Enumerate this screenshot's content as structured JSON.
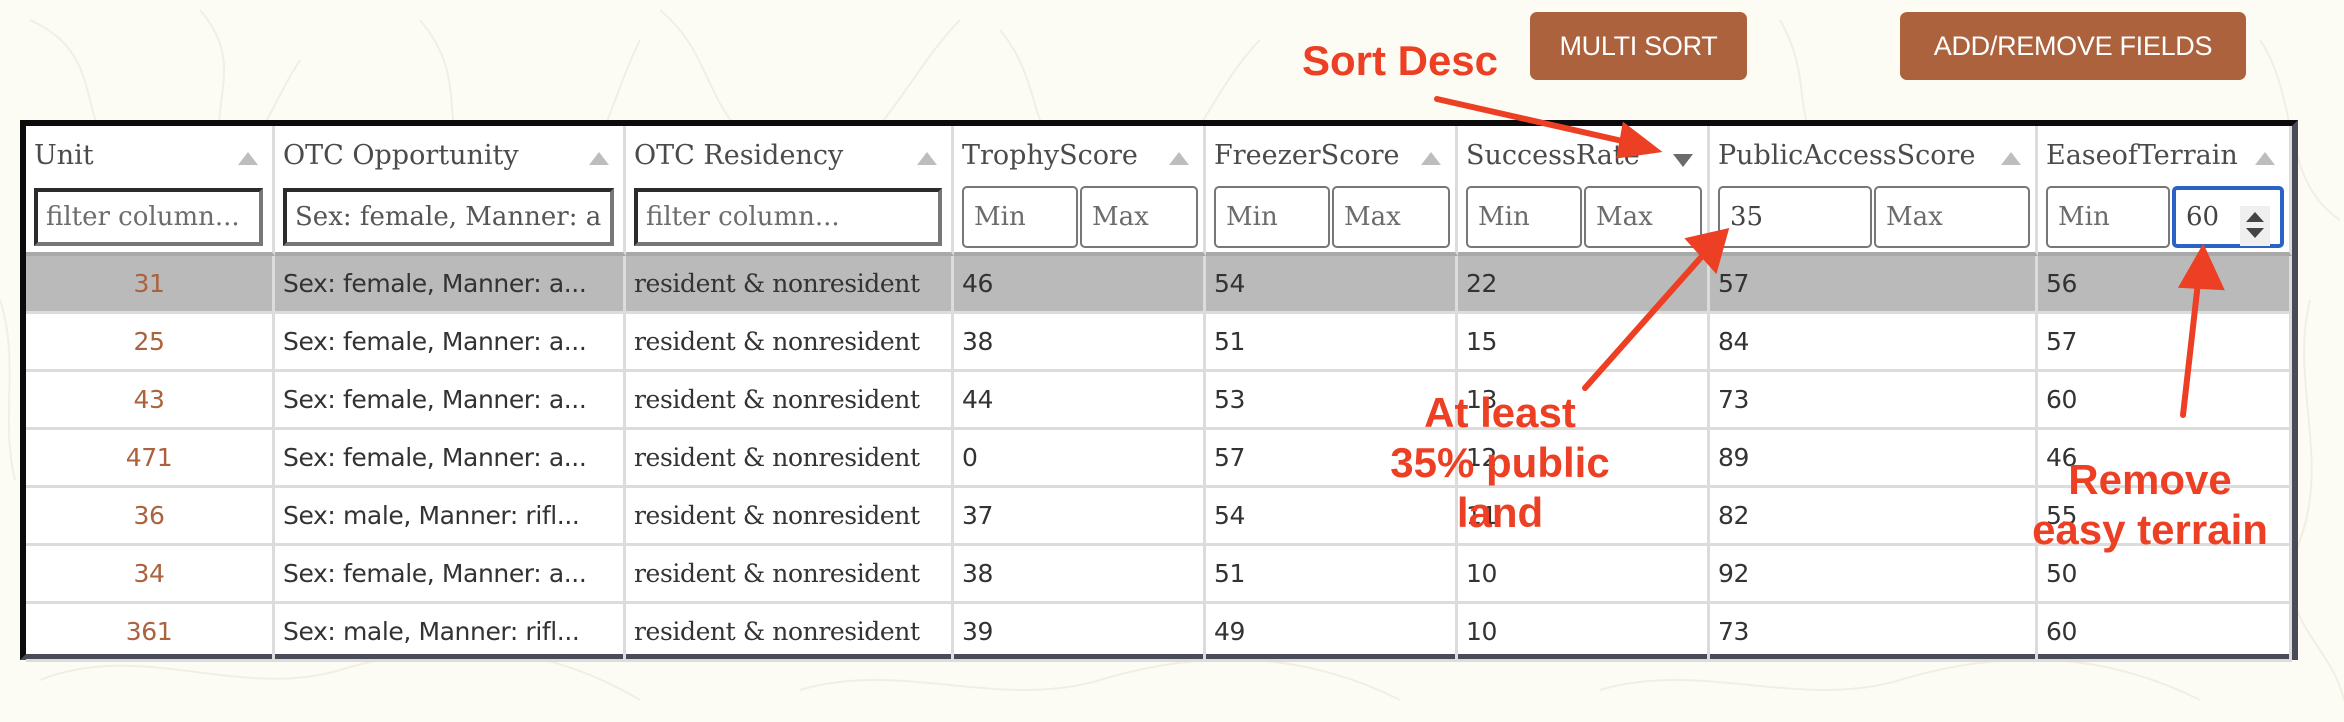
{
  "toolbar": {
    "multi_sort_label": "MULTI SORT",
    "add_remove_fields_label": "ADD/REMOVE FIELDS"
  },
  "columns": [
    {
      "title": "Unit",
      "sort": "asc",
      "filter": {
        "type": "text",
        "value": "",
        "placeholder": "filter column..."
      }
    },
    {
      "title": "OTC Opportunity",
      "sort": "asc",
      "filter": {
        "type": "text",
        "value": "Sex: female, Manner: a",
        "placeholder": "filter column..."
      }
    },
    {
      "title": "OTC Residency",
      "sort": "asc",
      "filter": {
        "type": "text",
        "value": "",
        "placeholder": "filter column..."
      }
    },
    {
      "title": "TrophyScore",
      "sort": "asc",
      "filter": {
        "type": "range",
        "min": "",
        "max": "",
        "min_placeholder": "Min",
        "max_placeholder": "Max"
      }
    },
    {
      "title": "FreezerScore",
      "sort": "asc",
      "filter": {
        "type": "range",
        "min": "",
        "max": "",
        "min_placeholder": "Min",
        "max_placeholder": "Max"
      }
    },
    {
      "title": "SuccessRate",
      "sort": "desc",
      "filter": {
        "type": "range",
        "min": "",
        "max": "",
        "min_placeholder": "Min",
        "max_placeholder": "Max"
      }
    },
    {
      "title": "PublicAccessScore",
      "sort": "asc",
      "filter": {
        "type": "range",
        "min": "35",
        "max": "",
        "min_placeholder": "Min",
        "max_placeholder": "Max"
      }
    },
    {
      "title": "EaseofTerrain",
      "sort": "asc",
      "filter": {
        "type": "range",
        "min": "",
        "max": "60",
        "min_placeholder": "Min",
        "max_placeholder": "Max",
        "focused": "max"
      }
    }
  ],
  "rows": [
    {
      "unit": "31",
      "opportunity": "Sex: female, Manner: a...",
      "residency": "resident & nonresident",
      "trophy": "46",
      "freezer": "54",
      "success": "22",
      "public": "57",
      "terrain": "56",
      "selected": true
    },
    {
      "unit": "25",
      "opportunity": "Sex: female, Manner: a...",
      "residency": "resident & nonresident",
      "trophy": "38",
      "freezer": "51",
      "success": "15",
      "public": "84",
      "terrain": "57"
    },
    {
      "unit": "43",
      "opportunity": "Sex: female, Manner: a...",
      "residency": "resident & nonresident",
      "trophy": "44",
      "freezer": "53",
      "success": "13",
      "public": "73",
      "terrain": "60"
    },
    {
      "unit": "471",
      "opportunity": "Sex: female, Manner: a...",
      "residency": "resident & nonresident",
      "trophy": "0",
      "freezer": "57",
      "success": "12",
      "public": "89",
      "terrain": "46"
    },
    {
      "unit": "36",
      "opportunity": "Sex: male, Manner: rifl...",
      "residency": "resident & nonresident",
      "trophy": "37",
      "freezer": "54",
      "success": "11",
      "public": "82",
      "terrain": "55"
    },
    {
      "unit": "34",
      "opportunity": "Sex: female, Manner: a...",
      "residency": "resident & nonresident",
      "trophy": "38",
      "freezer": "51",
      "success": "10",
      "public": "92",
      "terrain": "50"
    },
    {
      "unit": "361",
      "opportunity": "Sex: male, Manner: rifl...",
      "residency": "resident & nonresident",
      "trophy": "39",
      "freezer": "49",
      "success": "10",
      "public": "73",
      "terrain": "60"
    }
  ],
  "annotations": {
    "sort_desc": "Sort Desc",
    "public_land": [
      "At least",
      "35% public",
      "land"
    ],
    "terrain": [
      "Remove",
      "easy terrain"
    ],
    "color": "#ec3f24"
  },
  "colors": {
    "accent": "#ab623d",
    "focus": "#2a62c6",
    "selected_row": "#bababa",
    "background": "#fdfcf4"
  }
}
